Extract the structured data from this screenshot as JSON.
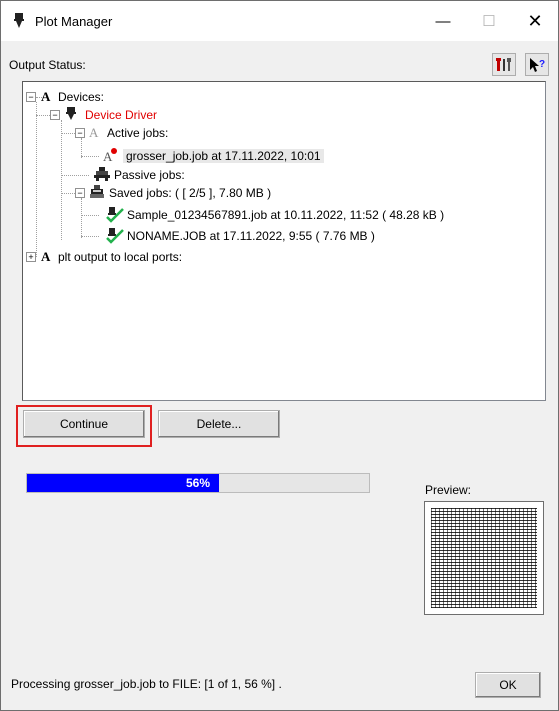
{
  "window": {
    "title": "Plot Manager",
    "min_glyph": "—",
    "max_glyph": "☐",
    "close_glyph": "✕"
  },
  "output_status_label": "Output Status:",
  "tree": {
    "devices": "Devices:",
    "device_driver": "Device Driver",
    "active_jobs": "Active jobs:",
    "active_job_item": "grosser_job.job at 17.11.2022, 10:01",
    "passive_jobs": "Passive jobs:",
    "saved_jobs": "Saved jobs: ( [ 2/5 ], 7.80 MB )",
    "saved_job_1": "Sample_01234567891.job at 10.11.2022, 11:52 ( 48.28 kB )",
    "saved_job_2": "NONAME.JOB at 17.11.2022, 9:55 ( 7.76 MB )",
    "plt_output": "plt output to local ports:",
    "expander_minus": "−",
    "expander_plus": "+"
  },
  "buttons": {
    "continue": "Continue",
    "delete": "Delete...",
    "ok": "OK"
  },
  "progress": {
    "value": 0.56,
    "label": "56%"
  },
  "preview_label": "Preview:",
  "status_text": "Processing grosser_job.job to FILE: [1 of 1, 56 %] .",
  "colors": {
    "accent_blue": "#0000ff",
    "driver_red": "#e00000",
    "highlight_outline": "#e02020",
    "check_green": "#22b14c"
  }
}
